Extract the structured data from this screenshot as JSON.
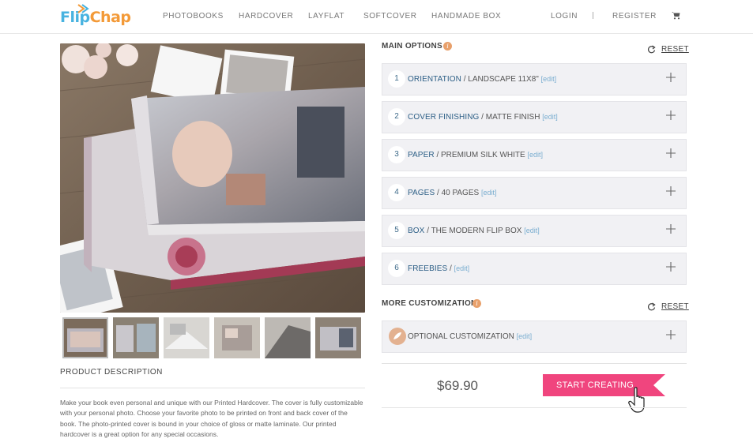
{
  "brand": {
    "logo_part1": "Flip",
    "logo_part2": "Chap",
    "colors": {
      "blue": "#48b3e0",
      "orange": "#f39a38"
    }
  },
  "nav": {
    "items": [
      "PHOTOBOOKS",
      "HARDCOVER",
      "LAYFLAT",
      "SOFTCOVER",
      "HANDMADE BOX"
    ],
    "login": "LOGIN",
    "register": "REGISTER",
    "cart_icon": "cart-icon"
  },
  "product": {
    "description_title": "PRODUCT DESCRIPTION",
    "description": "Make your book even personal and unique with our Printed Hardcover. The cover is fully customizable with your personal photo. Choose your favorite photo to be printed on front and back cover of the book. The photo-printed cover is bound in your choice of gloss or matte laminate. Our printed hardcover is a great option for any special occasions.",
    "thumbnail_count": 6
  },
  "main_options": {
    "title": "MAIN OPTIONS",
    "info_icon": "info-icon",
    "reset": "RESET",
    "items": [
      {
        "num": "1",
        "label": "ORIENTATION",
        "sep": " / ",
        "value": "LANDSCAPE 11X8\"",
        "edit": "[edit]"
      },
      {
        "num": "2",
        "label": "COVER FINISHING",
        "sep": " / ",
        "value": "MATTE FINISH",
        "edit": "[edit]"
      },
      {
        "num": "3",
        "label": "PAPER",
        "sep": " / ",
        "value": "PREMIUM SILK WHITE",
        "edit": "[edit]"
      },
      {
        "num": "4",
        "label": "PAGES",
        "sep": " / ",
        "value": "40 PAGES",
        "edit": "[edit]"
      },
      {
        "num": "5",
        "label": "BOX",
        "sep": " / ",
        "value": "THE MODERN FLIP BOX",
        "edit": "[edit]"
      },
      {
        "num": "6",
        "label": "FREEBIES",
        "sep": " / ",
        "value": "",
        "edit": "[edit]"
      }
    ]
  },
  "more_customization": {
    "title": "MORE CUSTOMIZATION",
    "reset": "RESET",
    "item": {
      "value": "OPTIONAL CUSTOMIZATION",
      "edit": "[edit]"
    }
  },
  "checkout": {
    "price": "$69.90",
    "cta": "START CREATING",
    "cta_color": "#f0457e"
  }
}
